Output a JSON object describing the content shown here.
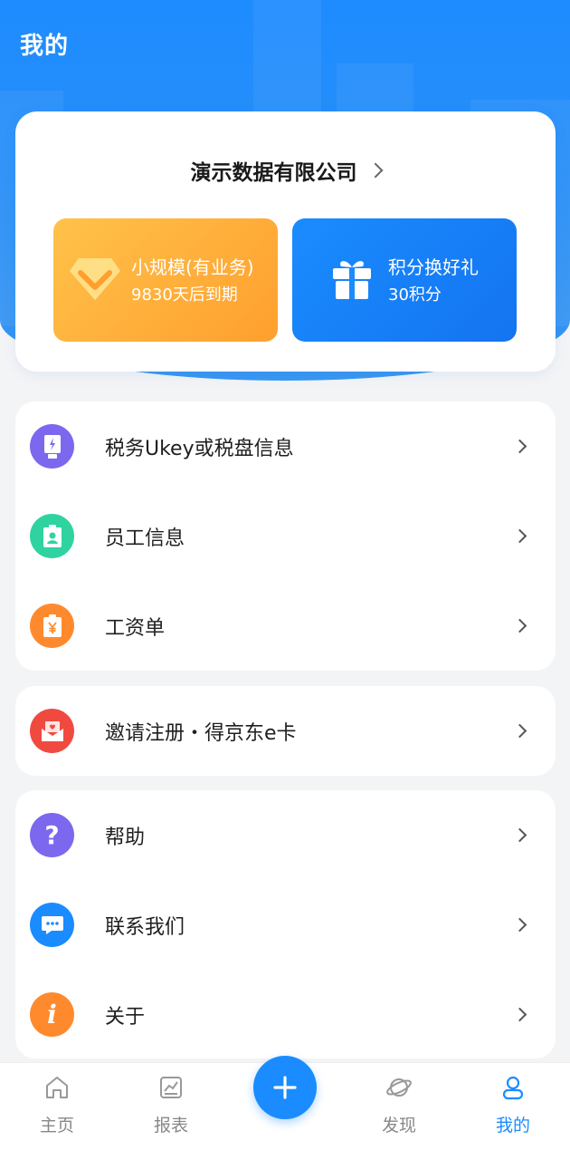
{
  "header": {
    "title": "我的"
  },
  "company": {
    "name": "演示数据有限公司"
  },
  "promos": [
    {
      "title": "小规模(有业务)",
      "subtitle": "9830天后到期",
      "icon": "diamond-icon"
    },
    {
      "title": "积分换好礼",
      "subtitle": "30积分",
      "icon": "gift-icon"
    }
  ],
  "menu_group_1": [
    {
      "label": "税务Ukey或税盘信息",
      "icon": "tax-ukey-icon",
      "color": "#7b68ee"
    },
    {
      "label": "员工信息",
      "icon": "employee-badge-icon",
      "color": "#2ed3a0"
    },
    {
      "label": "工资单",
      "icon": "payslip-icon",
      "color": "#ff8a2e"
    }
  ],
  "menu_group_2": [
    {
      "label": "邀请注册・得京东e卡",
      "icon": "invite-envelope-icon",
      "color": "#f04a40"
    }
  ],
  "menu_group_3": [
    {
      "label": "帮助",
      "icon": "help-icon",
      "color": "#7b68ee"
    },
    {
      "label": "联系我们",
      "icon": "chat-icon",
      "color": "#1a8cff"
    },
    {
      "label": "关于",
      "icon": "info-icon",
      "color": "#ff8a2e"
    }
  ],
  "tabbar": {
    "items": [
      {
        "label": "主页",
        "icon": "home-icon"
      },
      {
        "label": "报表",
        "icon": "report-icon"
      },
      {
        "label": "发现",
        "icon": "planet-icon"
      },
      {
        "label": "我的",
        "icon": "user-icon"
      }
    ],
    "active": "我的",
    "fab_icon": "plus-icon"
  },
  "colors": {
    "brand": "#1a8cff",
    "orange": "#ff9f2e"
  }
}
